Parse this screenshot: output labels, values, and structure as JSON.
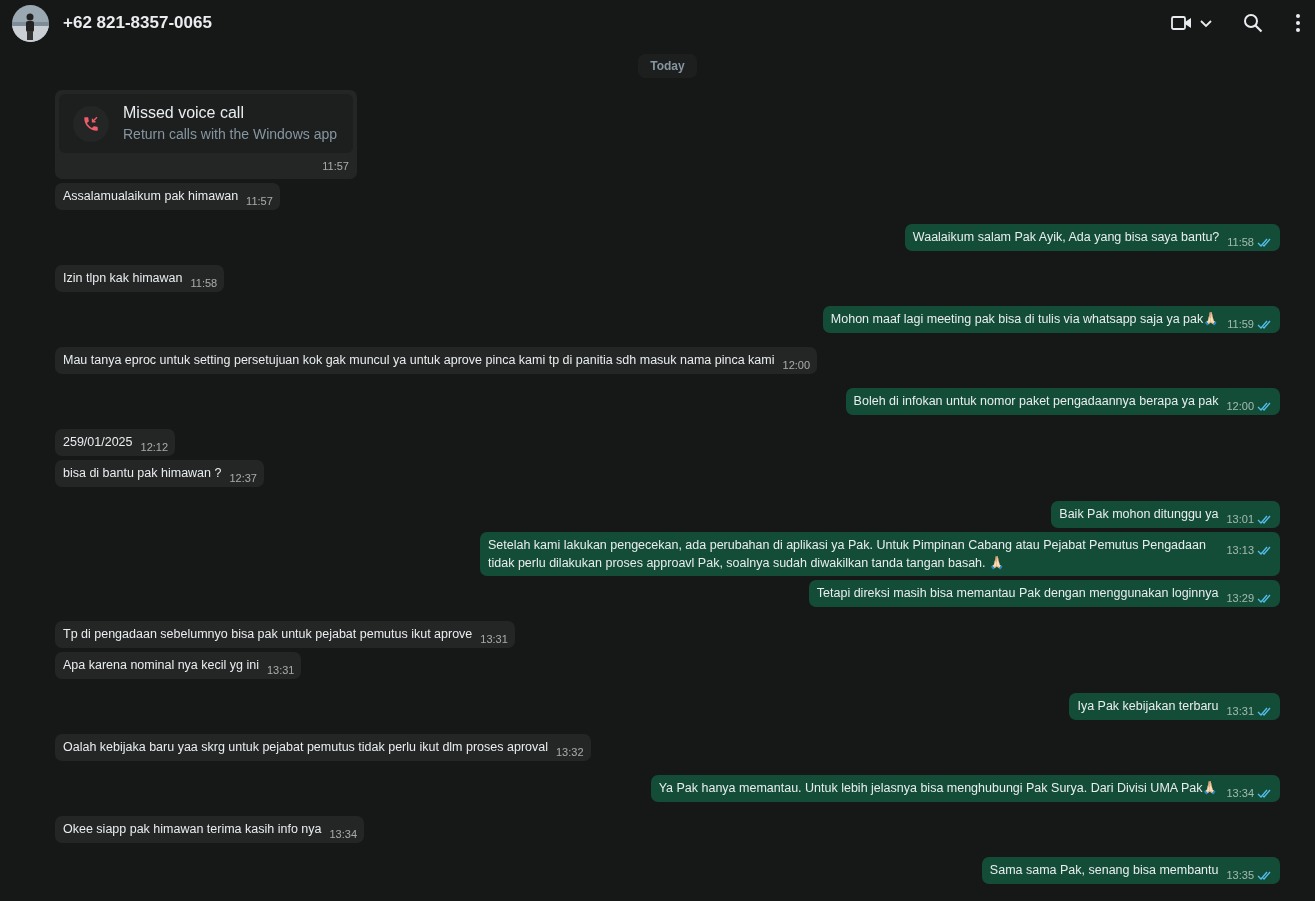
{
  "header": {
    "title": "+62 821-8357-0065"
  },
  "date_chip": "Today",
  "messages": [
    {
      "kind": "call",
      "outgoing": false,
      "title": "Missed voice call",
      "subtitle": "Return calls with the Windows app",
      "time": "11:57"
    },
    {
      "kind": "text",
      "outgoing": false,
      "text": "Assalamualaikum pak himawan",
      "time": "11:57"
    },
    {
      "kind": "text",
      "outgoing": true,
      "read": true,
      "text": "Waalaikum salam Pak Ayik, Ada yang bisa saya bantu?",
      "time": "11:58"
    },
    {
      "kind": "text",
      "outgoing": false,
      "text": "Izin tlpn kak himawan",
      "time": "11:58"
    },
    {
      "kind": "text",
      "outgoing": true,
      "read": true,
      "text": "Mohon maaf lagi meeting pak bisa di tulis via whatsapp saja ya pak🙏🏻",
      "time": "11:59"
    },
    {
      "kind": "text",
      "outgoing": false,
      "text": "Mau tanya eproc untuk setting persetujuan kok gak muncul ya untuk aprove pinca kami tp di panitia sdh masuk nama pinca kami",
      "time": "12:00"
    },
    {
      "kind": "text",
      "outgoing": true,
      "read": true,
      "text": "Boleh di infokan untuk nomor paket pengadaannya berapa ya pak",
      "time": "12:00"
    },
    {
      "kind": "text",
      "outgoing": false,
      "text": "259/01/2025",
      "time": "12:12"
    },
    {
      "kind": "text",
      "outgoing": false,
      "text": "bisa di bantu pak himawan ?",
      "time": "12:37"
    },
    {
      "kind": "text",
      "outgoing": true,
      "read": true,
      "text": "Baik Pak mohon ditunggu ya",
      "time": "13:01"
    },
    {
      "kind": "text",
      "outgoing": true,
      "read": true,
      "text": "Setelah kami lakukan pengecekan, ada perubahan di aplikasi ya Pak. Untuk Pimpinan Cabang atau Pejabat Pemutus Pengadaan tidak perlu dilakukan proses approavl Pak, soalnya sudah diwakilkan tanda tangan basah. 🙏🏻",
      "time": "13:13"
    },
    {
      "kind": "text",
      "outgoing": true,
      "read": true,
      "text": "Tetapi direksi masih bisa memantau Pak dengan menggunakan loginnya",
      "time": "13:29"
    },
    {
      "kind": "text",
      "outgoing": false,
      "text": "Tp di pengadaan sebelumnyo bisa pak untuk pejabat pemutus ikut aprove",
      "time": "13:31"
    },
    {
      "kind": "text",
      "outgoing": false,
      "text": "Apa karena nominal nya kecil yg ini",
      "time": "13:31"
    },
    {
      "kind": "text",
      "outgoing": true,
      "read": true,
      "text": "Iya Pak kebijakan terbaru",
      "time": "13:31"
    },
    {
      "kind": "text",
      "outgoing": false,
      "text": "Oalah kebijaka baru yaa skrg untuk pejabat pemutus tidak perlu ikut dlm proses aproval",
      "time": "13:32"
    },
    {
      "kind": "text",
      "outgoing": true,
      "read": true,
      "text": "Ya Pak hanya memantau. Untuk lebih jelasnya bisa menghubungi Pak Surya. Dari Divisi UMA Pak🙏🏻",
      "time": "13:34"
    },
    {
      "kind": "text",
      "outgoing": false,
      "text": "Okee siapp pak himawan terima kasih info nya",
      "time": "13:34"
    },
    {
      "kind": "text",
      "outgoing": true,
      "read": true,
      "text": "Sama sama Pak, senang bisa membantu",
      "time": "13:35"
    }
  ]
}
